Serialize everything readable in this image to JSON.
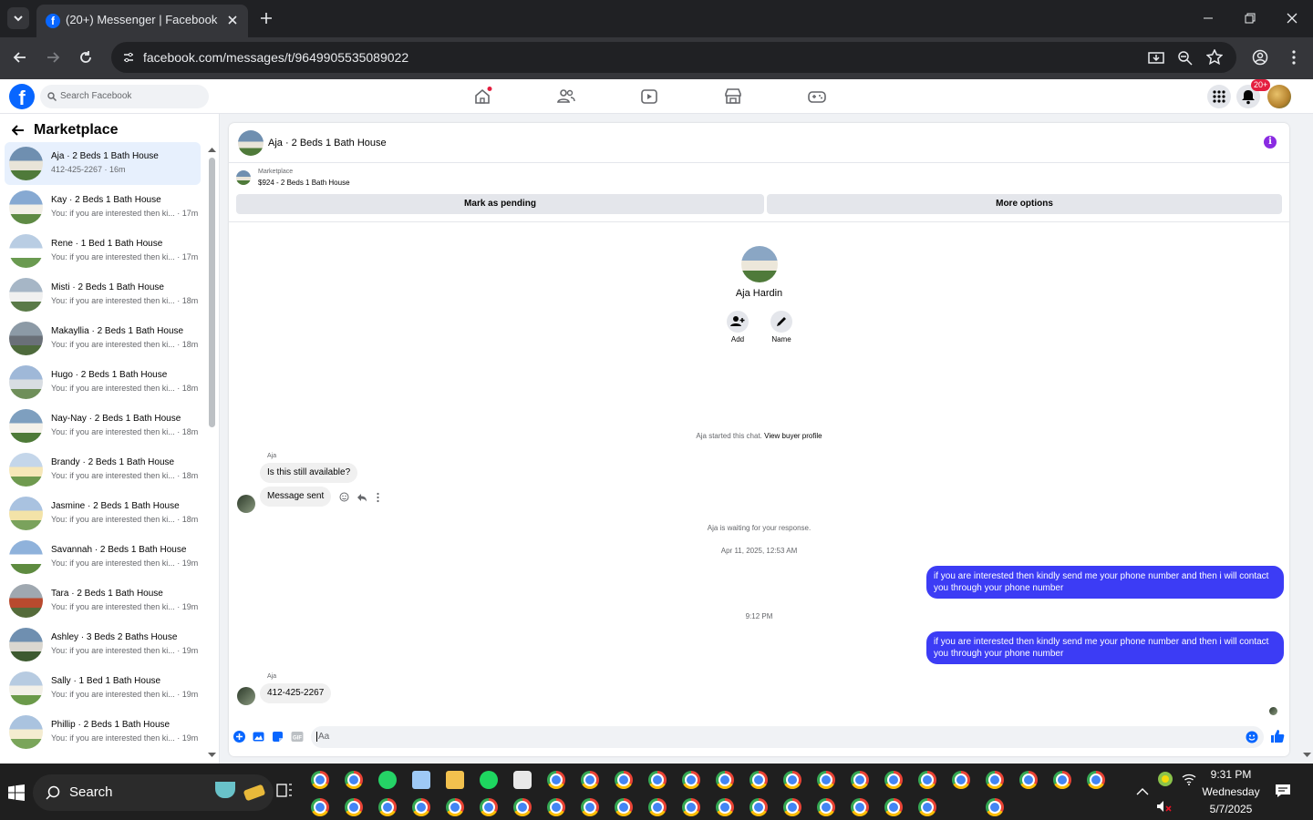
{
  "browser": {
    "tab_title": "(20+) Messenger | Facebook",
    "url": "facebook.com/messages/t/9649905535089022"
  },
  "header": {
    "search_placeholder": "Search Facebook",
    "notif_count": "20+"
  },
  "sidebar": {
    "title": "Marketplace",
    "conversations": [
      {
        "name": "Aja · 2 Beds 1 Bath House",
        "preview": "412-425-2267 · 16m",
        "active": true
      },
      {
        "name": "Kay · 2 Beds 1 Bath House",
        "preview": "You: if you are interested then ki...",
        "time": "17m"
      },
      {
        "name": "Rene · 1 Bed 1 Bath House",
        "preview": "You: if you are interested then ki...",
        "time": "17m"
      },
      {
        "name": "Misti · 2 Beds 1 Bath House",
        "preview": "You: if you are interested then ki...",
        "time": "18m"
      },
      {
        "name": "Makayllia · 2 Beds 1 Bath House",
        "preview": "You: if you are interested then ki...",
        "time": "18m"
      },
      {
        "name": "Hugo · 2 Beds 1 Bath House",
        "preview": "You: if you are interested then ki...",
        "time": "18m"
      },
      {
        "name": "Nay-Nay · 2 Beds 1 Bath House",
        "preview": "You: if you are interested then ki...",
        "time": "18m"
      },
      {
        "name": "Brandy · 2 Beds 1 Bath House",
        "preview": "You: if you are interested then ki...",
        "time": "18m"
      },
      {
        "name": "Jasmine · 2 Beds 1 Bath House",
        "preview": "You: if you are interested then ki...",
        "time": "18m"
      },
      {
        "name": "Savannah · 2 Beds 1 Bath House",
        "preview": "You: if you are interested then ki...",
        "time": "19m"
      },
      {
        "name": "Tara · 2 Beds 1 Bath House",
        "preview": "You: if you are interested then ki...",
        "time": "19m"
      },
      {
        "name": "Ashley · 3 Beds 2 Baths House",
        "preview": "You: if you are interested then ki...",
        "time": "19m"
      },
      {
        "name": "Sally · 1 Bed 1 Bath House",
        "preview": "You: if you are interested then ki...",
        "time": "19m"
      },
      {
        "name": "Phillip · 2 Beds 1 Bath House",
        "preview": "You: if you are interested then ki...",
        "time": "19m"
      }
    ]
  },
  "chat": {
    "title": "Aja · 2 Beds 1 Bath House",
    "listing_label": "Marketplace",
    "listing_price": "$924 - 2 Beds 1 Bath House",
    "mark_pending": "Mark as pending",
    "more_options": "More options",
    "profile_name": "Aja Hardin",
    "add_label": "Add",
    "name_label": "Name",
    "started_text": "Aja started this chat.",
    "view_profile": "View buyer profile",
    "sender1": "Aja",
    "msg1": "Is this still available?",
    "msg2": "Message sent",
    "waiting": "Aja is waiting for your response.",
    "date1": "Apr 11, 2025, 12:53 AM",
    "out1": "if you are interested then kindly send me your phone number and then i will contact you through your phone number",
    "time2": "9:12 PM",
    "out2": "if you are interested then kindly send me your phone number and then i will contact you through your phone number",
    "sender2": "Aja",
    "msg3": "412-425-2267",
    "composer_placeholder": "Aa"
  },
  "taskbar": {
    "search_label": "Search",
    "time": "9:31 PM",
    "day": "Wednesday",
    "date": "5/7/2025"
  },
  "colors": {
    "fb_blue": "#0866ff",
    "outgoing_bubble": "#3c3cf5",
    "notif_red": "#e41e3f",
    "info_purple": "#8a2be2"
  }
}
